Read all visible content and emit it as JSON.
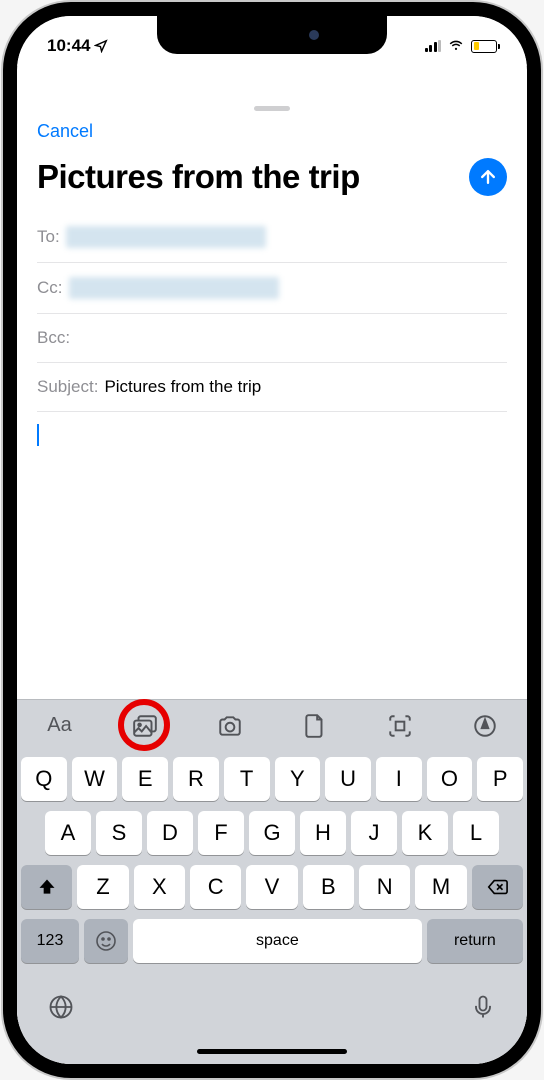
{
  "status": {
    "time": "10:44"
  },
  "compose": {
    "cancel_label": "Cancel",
    "title": "Pictures from the trip",
    "to_label": "To:",
    "cc_label": "Cc:",
    "bcc_label": "Bcc:",
    "subject_label": "Subject:",
    "subject_value": "Pictures from the trip"
  },
  "keyboard": {
    "toolbar": {
      "format": "Aa"
    },
    "row1": [
      "Q",
      "W",
      "E",
      "R",
      "T",
      "Y",
      "U",
      "I",
      "O",
      "P"
    ],
    "row2": [
      "A",
      "S",
      "D",
      "F",
      "G",
      "H",
      "J",
      "K",
      "L"
    ],
    "row3": [
      "Z",
      "X",
      "C",
      "V",
      "B",
      "N",
      "M"
    ],
    "num_key": "123",
    "space_key": "space",
    "return_key": "return"
  }
}
